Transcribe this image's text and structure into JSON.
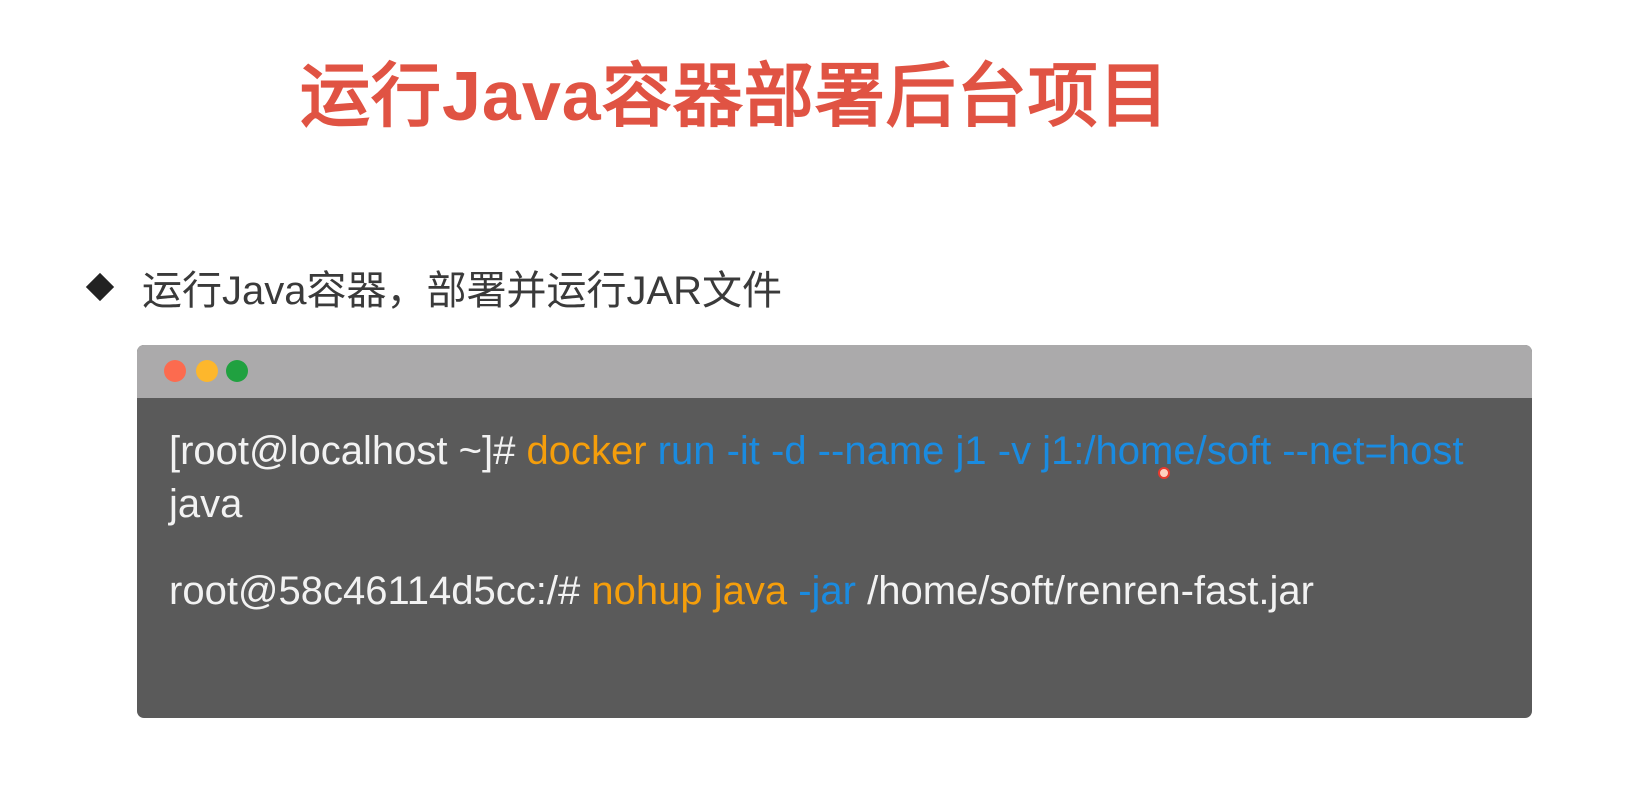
{
  "title": "运行Java容器部署后台项目",
  "bullet": "运行Java容器，部署并运行JAR文件",
  "terminal": {
    "line1": {
      "prompt": "[root@localhost ~]# ",
      "cmd": "docker",
      "args": " run  -it  -d  --name  j1  -v j1:/home/soft  --net=host ",
      "tail": "java"
    },
    "line2": {
      "prompt": "root@58c46114d5cc:/# ",
      "cmd": "nohup  java",
      "args": "  -jar ",
      "tail": " /home/soft/renren-fast.jar"
    }
  },
  "colors": {
    "title": "#e05343",
    "command": "#f59e0b",
    "argument": "#1a8be0"
  }
}
